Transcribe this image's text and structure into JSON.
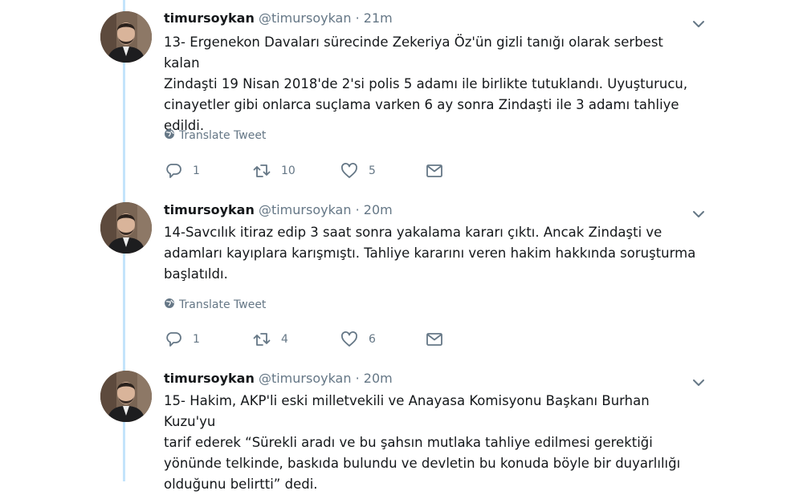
{
  "icons": {
    "avatar": "avatar-image",
    "caret": "chevron-down-icon",
    "globe": "globe-icon",
    "reply": "reply-icon",
    "retweet": "retweet-icon",
    "like": "heart-icon",
    "dm": "envelope-icon"
  },
  "colors": {
    "thread_line": "#c4e4fb",
    "secondary_text": "#657786",
    "primary_text": "#14171a"
  },
  "tweets": [
    {
      "name": "timursoykan",
      "handle": "@timursoykan",
      "separator": "·",
      "time": "21m",
      "text": "13- Ergenekon Davaları sürecinde Zekeriya Öz'ün gizli tanığı olarak serbest kalan\nZindaşti 19 Nisan 2018'de 2'si polis 5 adamı ile birlikte tutuklandı. Uyuşturucu,\ncinayetler gibi onlarca suçlama varken 6 ay sonra Zindaşti ile 3 adamı tahliye\nedildi.",
      "translate": "Translate Tweet",
      "replies": "1",
      "retweets": "10",
      "likes": "5"
    },
    {
      "name": "timursoykan",
      "handle": "@timursoykan",
      "separator": "·",
      "time": "20m",
      "text": "14-Savcılık itiraz edip 3 saat sonra yakalama kararı çıktı. Ancak Zindaşti ve\nadamları kayıplara karışmıştı. Tahliye kararını veren hakim hakkında soruşturma\nbaşlatıldı.",
      "translate": "Translate Tweet",
      "replies": "1",
      "retweets": "4",
      "likes": "6"
    },
    {
      "name": "timursoykan",
      "handle": "@timursoykan",
      "separator": "·",
      "time": "20m",
      "text": "15- Hakim, AKP'li eski milletvekili ve Anayasa Komisyonu Başkanı Burhan Kuzu'yu\ntarif ederek “Sürekli aradı ve bu şahsın mutlaka tahliye edilmesi gerektiği\nyönünde telkinde, baskıda bulundu ve devletin bu konuda böyle bir duyarlılığı\nolduğunu belirtti” dedi."
    }
  ]
}
